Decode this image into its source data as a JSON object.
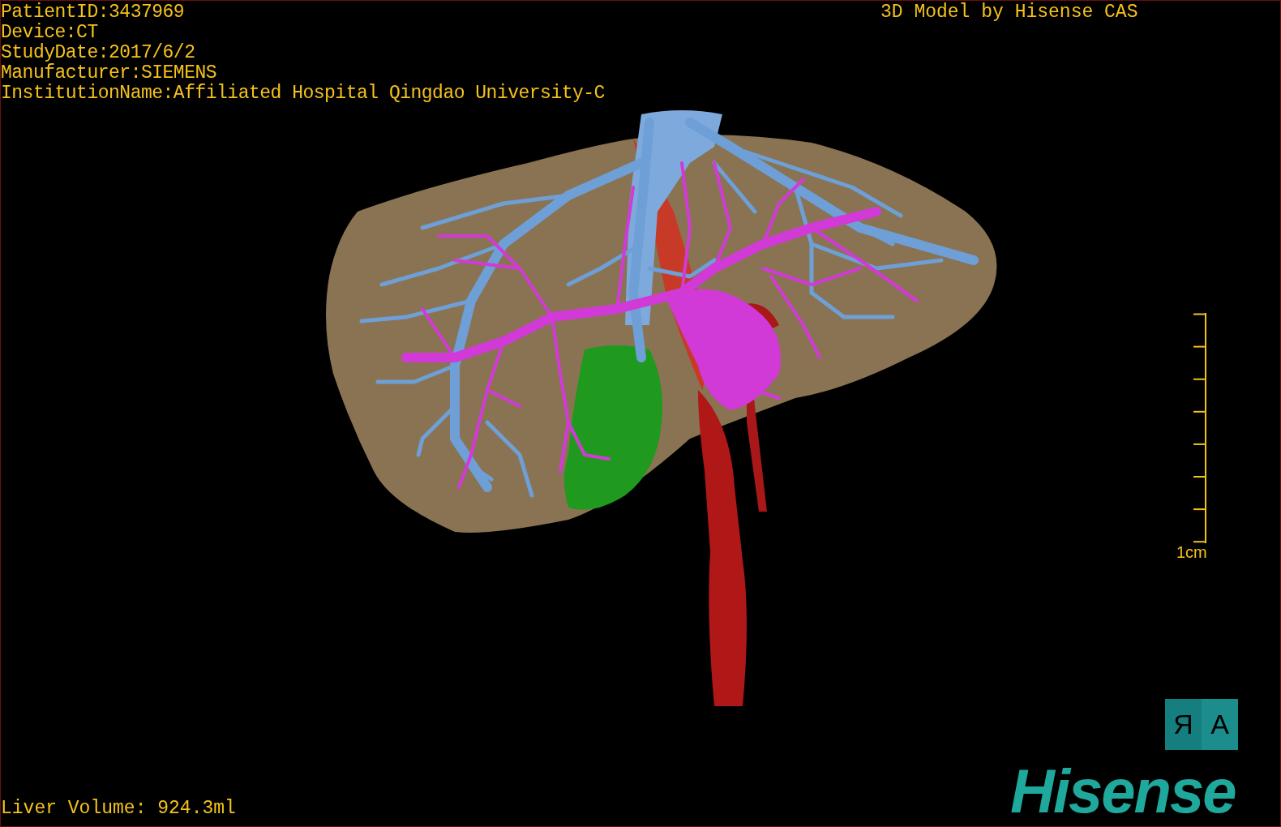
{
  "patient_info": [
    "PatientID:3437969",
    "Device:CT",
    "StudyDate:2017/6/2",
    "Manufacturer:SIEMENS",
    "InstitutionName:Affiliated Hospital Qingdao University-C"
  ],
  "credit": "3D Model by Hisense CAS",
  "scale_bar": {
    "label": "1cm"
  },
  "orientation_cube": {
    "faces": [
      "R",
      "A"
    ]
  },
  "liver_volume": "Liver Volume: 924.3ml",
  "logo": "Hisense"
}
